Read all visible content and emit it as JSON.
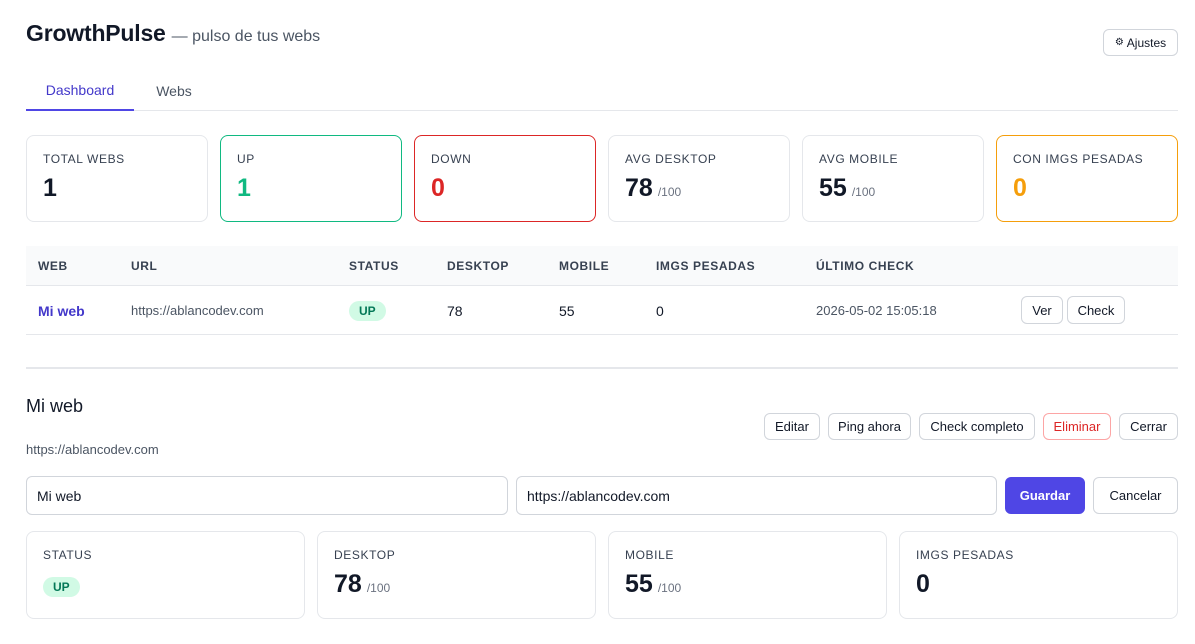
{
  "app": {
    "name": "GrowthPulse",
    "tagline": "— pulso de tus webs",
    "settings_label": "Ajustes",
    "settings_icon": "gear-icon"
  },
  "tabs": [
    {
      "label": "Dashboard",
      "active": true
    },
    {
      "label": "Webs",
      "active": false
    }
  ],
  "stats": [
    {
      "label": "TOTAL WEBS",
      "value": "1",
      "suffix": ""
    },
    {
      "label": "UP",
      "value": "1",
      "suffix": ""
    },
    {
      "label": "DOWN",
      "value": "0",
      "suffix": ""
    },
    {
      "label": "AVG DESKTOP",
      "value": "78",
      "suffix": "/100"
    },
    {
      "label": "AVG MOBILE",
      "value": "55",
      "suffix": "/100"
    },
    {
      "label": "CON IMGS PESADAS",
      "value": "0",
      "suffix": ""
    }
  ],
  "table": {
    "columns": [
      "WEB",
      "URL",
      "STATUS",
      "DESKTOP",
      "MOBILE",
      "IMGS PESADAS",
      "ÚLTIMO CHECK"
    ],
    "rows": [
      {
        "web": "Mi web",
        "url": "https://ablancodev.com",
        "status": "UP",
        "desktop": "78",
        "mobile": "55",
        "imgs": "0",
        "last_check": "2026-05-02 15:05:18",
        "view_label": "Ver",
        "check_label": "Check"
      }
    ]
  },
  "detail": {
    "title": "Mi web",
    "url": "https://ablancodev.com",
    "actions": {
      "edit": "Editar",
      "ping": "Ping ahora",
      "full_check": "Check completo",
      "delete": "Eliminar",
      "close": "Cerrar"
    },
    "form": {
      "name_value": "Mi web",
      "url_value": "https://ablancodev.com",
      "save": "Guardar",
      "cancel": "Cancelar"
    },
    "cards": [
      {
        "label": "STATUS",
        "badge": "UP"
      },
      {
        "label": "DESKTOP",
        "value": "78",
        "suffix": "/100"
      },
      {
        "label": "MOBILE",
        "value": "55",
        "suffix": "/100"
      },
      {
        "label": "IMGS PESADAS",
        "value": "0",
        "suffix": ""
      }
    ]
  },
  "colors": {
    "accent": "#4f46e5",
    "up": "#10b981",
    "down": "#dc2626",
    "warning": "#f59e0b"
  }
}
